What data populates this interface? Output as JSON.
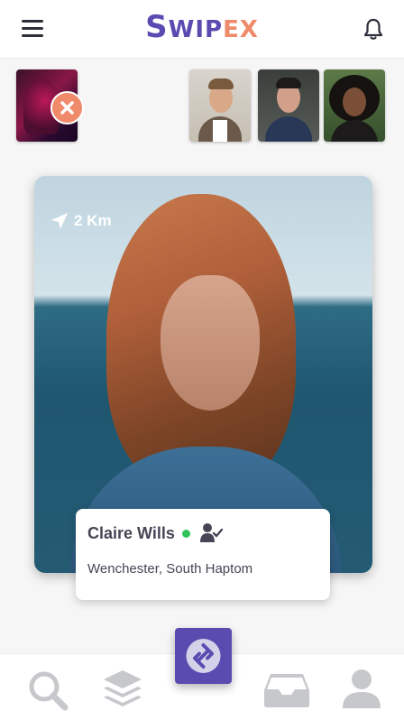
{
  "header": {
    "logo_letters": [
      {
        "char": "S",
        "color": "#5a4bb1"
      },
      {
        "char": "W",
        "color": "#5a4bb1"
      },
      {
        "char": "I",
        "color": "#5a4bb1"
      },
      {
        "char": "P",
        "color": "#5a4bb1"
      },
      {
        "char": "E",
        "color": "#ef8a6a"
      },
      {
        "char": "X",
        "color": "#ef8a6a"
      }
    ]
  },
  "stories": {
    "my_story_icon": "close-icon",
    "people_icons": [
      "avatar-man-1",
      "avatar-man-2",
      "avatar-woman-1"
    ]
  },
  "card": {
    "distance": "2 Km",
    "distance_icon": "location-arrow-icon",
    "name": "Claire Wills",
    "online_color": "#2ec35a",
    "verified_icon": "user-check-icon",
    "location": "Wenchester, South Haptom"
  },
  "nav": {
    "items": [
      "search-icon",
      "layers-icon",
      "swipex-icon",
      "inbox-icon",
      "user-icon"
    ],
    "accent": "#5a4bb1",
    "inactive_color": "#c6c8cc"
  }
}
